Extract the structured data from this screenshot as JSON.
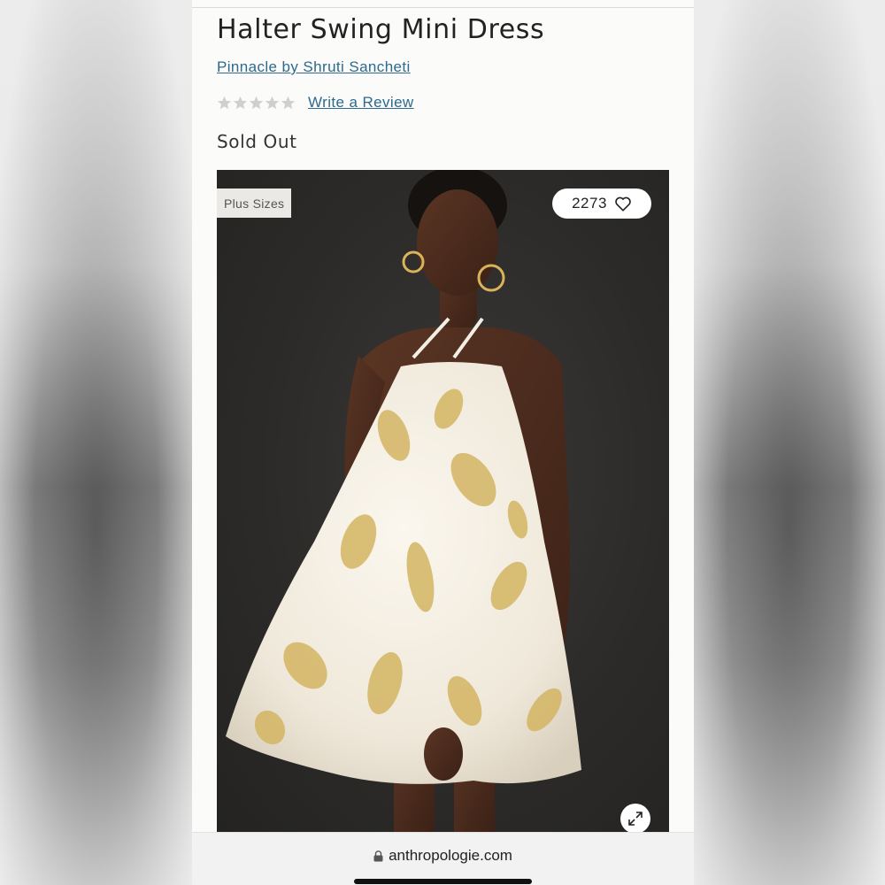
{
  "product": {
    "title": "Halter Swing Mini Dress",
    "brand": "Pinnacle by Shruti Sancheti",
    "rating": {
      "stars": 0,
      "max": 5,
      "write_review_label": "Write a Review"
    },
    "status": "Sold Out"
  },
  "image": {
    "badge": "Plus Sizes",
    "favorites_count": "2273",
    "favorite_icon": "heart-icon",
    "zoom_icon": "expand-icon"
  },
  "browser": {
    "url": "anthropologie.com",
    "secure_icon": "lock-icon"
  },
  "colors": {
    "link": "#2d6a8e",
    "text": "#222222",
    "star_empty": "#cfcfcf",
    "hero_background": "#2c2b29"
  }
}
